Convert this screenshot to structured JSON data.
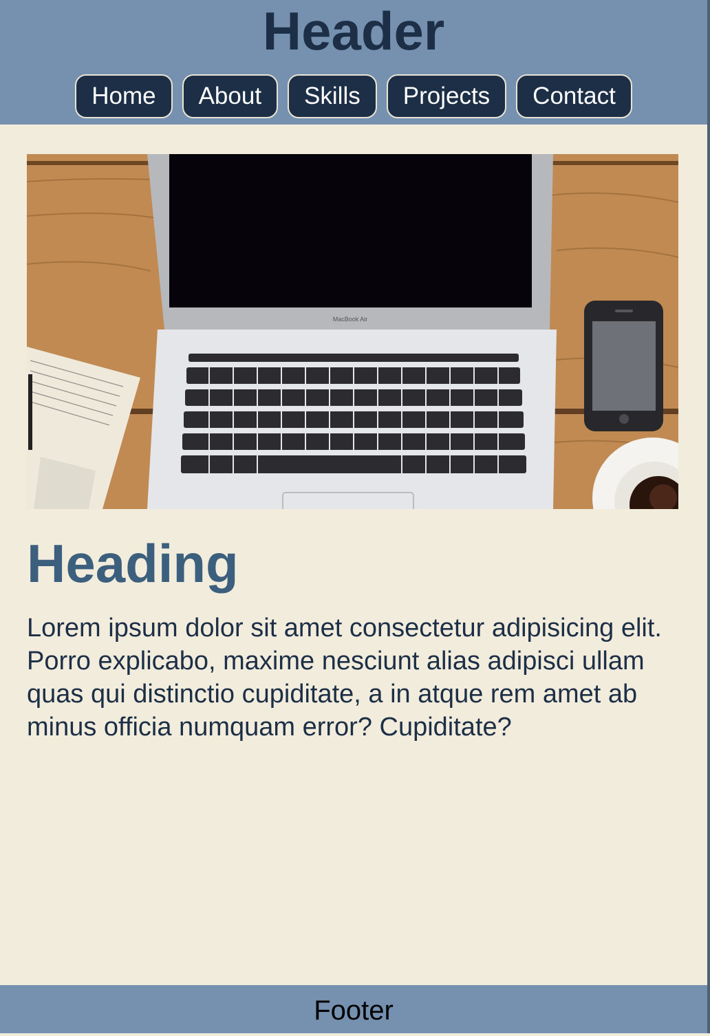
{
  "header": {
    "title": "Header",
    "nav": [
      {
        "label": "Home"
      },
      {
        "label": "About"
      },
      {
        "label": "Skills"
      },
      {
        "label": "Projects"
      },
      {
        "label": "Contact"
      }
    ]
  },
  "main": {
    "image_subject": "laptop-on-wooden-desk-with-phone-notebook-and-coffee",
    "laptop_brand_text": "MacBook Air",
    "heading": "Heading",
    "paragraph": "Lorem ipsum dolor sit amet consectetur adipisicing elit. Porro explicabo, maxime nesciunt alias adipisci ullam quas qui distinctio cupiditate, a in atque rem amet ab minus officia numquam error? Cupiditate?"
  },
  "footer": {
    "text": "Footer"
  },
  "colors": {
    "header_bg": "#7591af",
    "header_text": "#1d2f47",
    "nav_button_bg": "#1d2f47",
    "page_bg": "#f2ecdc",
    "heading_color": "#3d5f7e",
    "text_color": "#1d2f47"
  }
}
